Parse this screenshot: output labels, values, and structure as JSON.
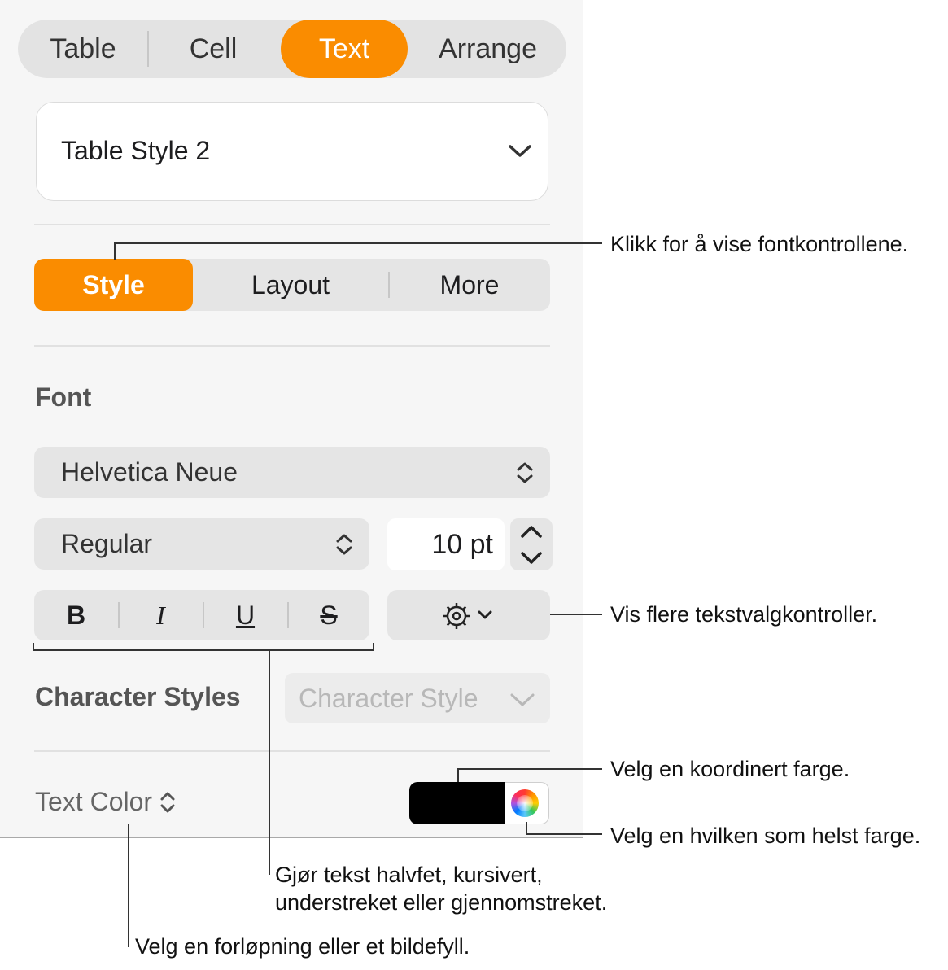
{
  "tabs": {
    "table": "Table",
    "cell": "Cell",
    "text": "Text",
    "arrange": "Arrange"
  },
  "paragraph_style": "Table Style 2",
  "subtabs": {
    "style": "Style",
    "layout": "Layout",
    "more": "More"
  },
  "font": {
    "section_title": "Font",
    "family": "Helvetica Neue",
    "typeface": "Regular",
    "size": "10 pt",
    "bold": "B",
    "italic": "I",
    "underline": "U",
    "strikethrough": "S"
  },
  "character_styles": {
    "label": "Character Styles",
    "placeholder": "Character Style"
  },
  "text_color": {
    "label": "Text Color",
    "swatch_color": "#000000"
  },
  "colors": {
    "accent": "#fa8c00"
  },
  "callouts": {
    "font_controls": "Klikk for å vise fontkontrollene.",
    "more_options": "Vis flere tekstvalgkontroller.",
    "coordinated_color": "Velg en koordinert farge.",
    "any_color": "Velg en hvilken som helst farge.",
    "format_line1": "Gjør tekst halvfet, kursivert,",
    "format_line2": "understreket eller gjennomstreket.",
    "gradient": "Velg en forløpning eller et bildefyll."
  }
}
